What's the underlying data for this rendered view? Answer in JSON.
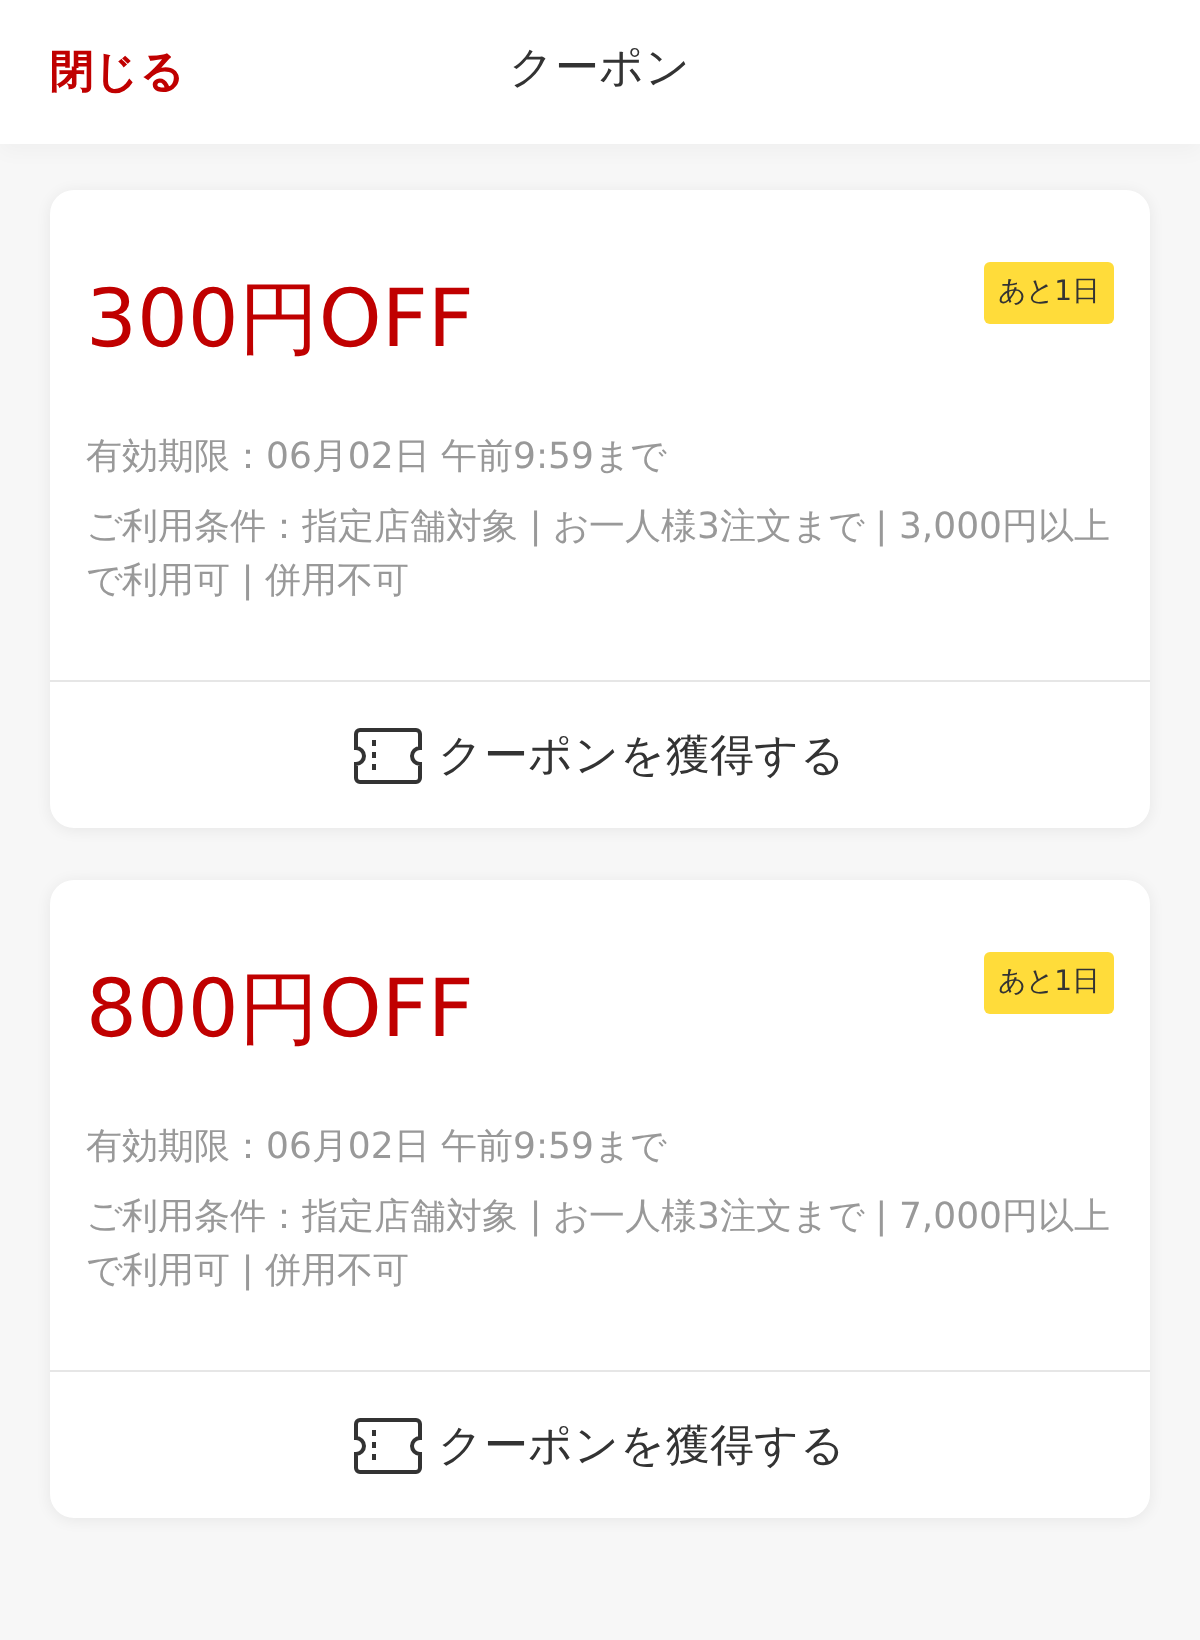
{
  "header": {
    "close": "閉じる",
    "title": "クーポン"
  },
  "coupons": [
    {
      "discount": "300円OFF",
      "badge": "あと1日",
      "expiry": "有効期限：06月02日 午前9:59まで",
      "conditions": "ご利用条件：指定店舗対象 | お一人様3注文まで | 3,000円以上で利用可 | 併用不可",
      "button": "クーポンを獲得する"
    },
    {
      "discount": "800円OFF",
      "badge": "あと1日",
      "expiry": "有効期限：06月02日 午前9:59まで",
      "conditions": "ご利用条件：指定店舗対象 | お一人様3注文まで | 7,000円以上で利用可 | 併用不可",
      "button": "クーポンを獲得する"
    }
  ]
}
